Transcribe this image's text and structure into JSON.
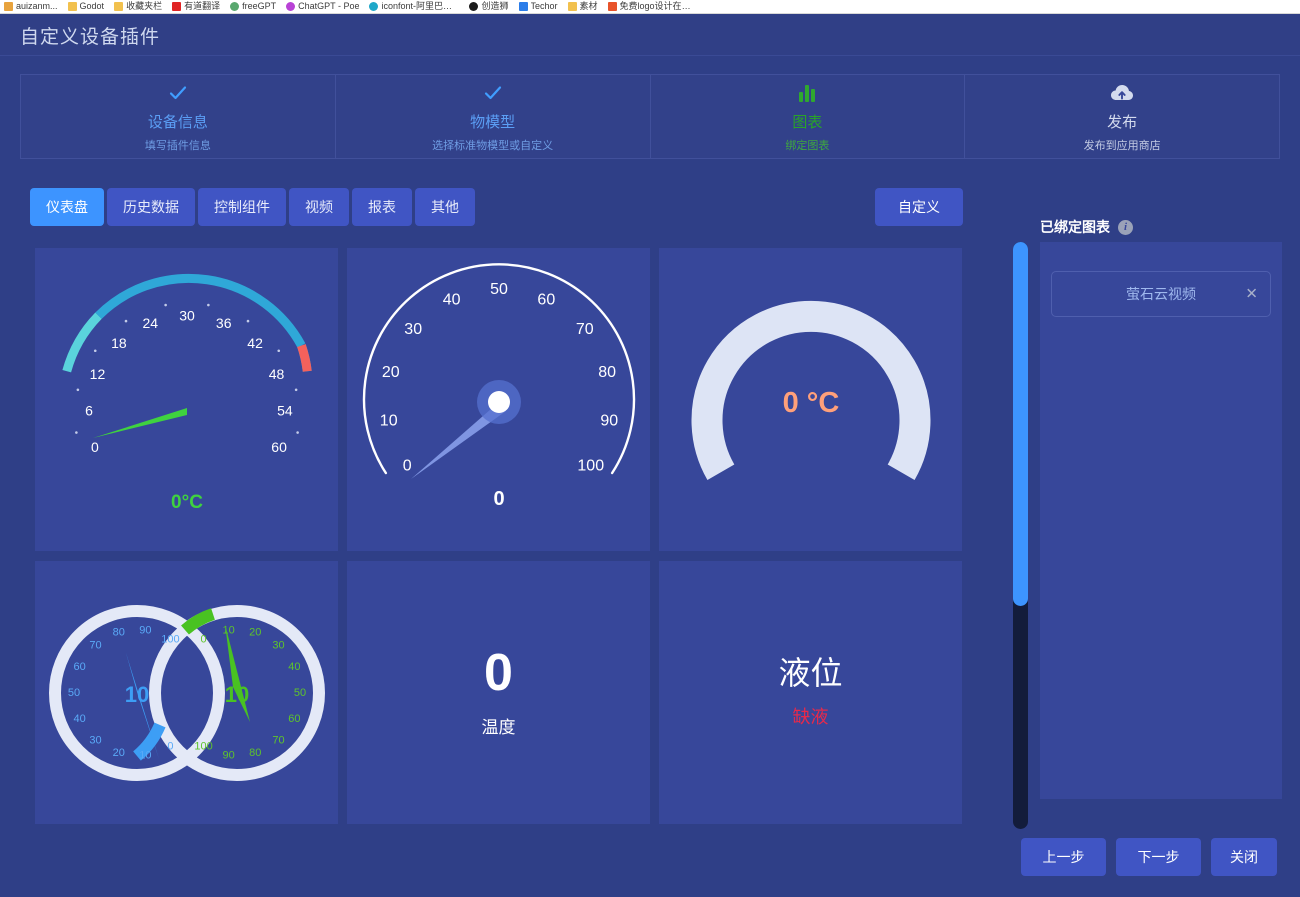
{
  "browser": {
    "bookmarks": [
      {
        "label": "auizanm...",
        "color": "#e8a33d",
        "icon": "bookmark-icon"
      },
      {
        "label": "Godot",
        "color": "#f2c14e",
        "icon": "folder-icon"
      },
      {
        "label": "收藏夹栏",
        "color": "#f2c14e",
        "icon": "folder-icon"
      },
      {
        "label": "有道翻译",
        "color": "#e02424",
        "icon": "youdao-icon"
      },
      {
        "label": "freeGPT",
        "color": "#5aa86f",
        "icon": "freegpt-icon"
      },
      {
        "label": "ChatGPT - Poe",
        "color": "#b942d6",
        "icon": "poe-icon"
      },
      {
        "label": "iconfont-阿里巴巴...",
        "color": "#1fa8c9",
        "icon": "iconfont-icon"
      },
      {
        "label": "创造狮",
        "color": "#1b1b1b",
        "icon": "chuangzaoshi-icon"
      },
      {
        "label": "Techor",
        "color": "#2b7de9",
        "icon": "techor-icon"
      },
      {
        "label": "素材",
        "color": "#f2c14e",
        "icon": "folder-icon"
      },
      {
        "label": "免费logo设计在线...",
        "color": "#e8532a",
        "icon": "logo-design-icon"
      }
    ]
  },
  "header": {
    "title": "自定义设备插件"
  },
  "steps": [
    {
      "title": "设备信息",
      "subtitle": "填写插件信息",
      "icon": "check-icon",
      "state": "done"
    },
    {
      "title": "物模型",
      "subtitle": "选择标准物模型或自定义",
      "icon": "check-icon",
      "state": "done"
    },
    {
      "title": "图表",
      "subtitle": "绑定图表",
      "icon": "bar-chart-icon",
      "state": "active"
    },
    {
      "title": "发布",
      "subtitle": "发布到应用商店",
      "icon": "cloud-upload-icon",
      "state": "pending"
    }
  ],
  "tabs": [
    {
      "label": "仪表盘",
      "selected": true
    },
    {
      "label": "历史数据",
      "selected": false
    },
    {
      "label": "控制组件",
      "selected": false
    },
    {
      "label": "视频",
      "selected": false
    },
    {
      "label": "报表",
      "selected": false
    },
    {
      "label": "其他",
      "selected": false
    }
  ],
  "toolbar": {
    "custom_label": "自定义"
  },
  "bound_panel": {
    "title": "已绑定图表",
    "info_glyph": "i",
    "items": [
      {
        "label": "萤石云视频",
        "remove_glyph": "✕"
      }
    ]
  },
  "footer": {
    "prev_label": "上一步",
    "next_label": "下一步",
    "close_label": "关闭"
  },
  "colors": {
    "page_bg": "#2f3f87",
    "card_bg": "#37479a",
    "accent": "#3d94ff",
    "tab_bg": "#4055c4",
    "green": "#37c837",
    "red": "#f4615c",
    "teal": "#4fd0d8",
    "salmon": "#ffa07a",
    "crimson": "#e8294a"
  },
  "chart_data": [
    {
      "id": "gauge-temperature-60",
      "type": "gauge",
      "title": "",
      "value": 0,
      "value_label": "0°C",
      "min": 0,
      "max": 60,
      "tick_labels": [
        "0",
        "6",
        "12",
        "18",
        "24",
        "30",
        "36",
        "42",
        "48",
        "54",
        "60"
      ],
      "tick_step": 6,
      "start_angle": 200,
      "end_angle": -20,
      "needle_color": "#3fd23f",
      "value_color": "#3fd23f",
      "arc_segments": [
        {
          "from": 0,
          "to": 18,
          "color": "#5ad3dc"
        },
        {
          "from": 18,
          "to": 46,
          "color": "#2fa8d8"
        },
        {
          "from": 46,
          "to": 60,
          "color": "#f4615c"
        }
      ]
    },
    {
      "id": "gauge-percent-100-thin",
      "type": "gauge",
      "title": "",
      "value": 0,
      "value_label": "0",
      "min": 0,
      "max": 100,
      "tick_labels": [
        "0",
        "10",
        "20",
        "30",
        "40",
        "50",
        "60",
        "70",
        "80",
        "90",
        "100"
      ],
      "tick_step": 10,
      "start_angle": 215,
      "end_angle": -35,
      "needle_color": "#7c93e0",
      "value_color": "#ffffff",
      "arc_color": "#ffffff"
    },
    {
      "id": "gauge-temperature-ring",
      "type": "gauge",
      "title": "",
      "value": 0,
      "value_label": "0 °C",
      "min": 0,
      "max": 100,
      "tick_labels": [],
      "start_angle": 210,
      "end_angle": -30,
      "arc_color": "#dde4f5",
      "value_color": "#ffa07a"
    },
    {
      "id": "gauge-dual-100",
      "type": "gauge",
      "sub_gauges": [
        {
          "name": "left",
          "value": 10,
          "value_label": "10",
          "min": 0,
          "max": 100,
          "tick_labels": [
            "0",
            "10",
            "20",
            "30",
            "40",
            "50",
            "60",
            "70",
            "80",
            "90",
            "100"
          ],
          "color": "#3d9ef5",
          "direction": "counterclockwise"
        },
        {
          "name": "right",
          "value": 10,
          "value_label": "10",
          "min": 0,
          "max": 100,
          "tick_labels": [
            "0",
            "10",
            "20",
            "30",
            "40",
            "50",
            "60",
            "70",
            "80",
            "90",
            "100"
          ],
          "color": "#49c222",
          "direction": "clockwise"
        }
      ],
      "ring_color": "#e4e9f7"
    },
    {
      "id": "digit-temperature",
      "type": "digit",
      "value": "0",
      "label": "温度",
      "value_color": "#ffffff",
      "label_color": "#ffffff"
    },
    {
      "id": "status-liquid-level",
      "type": "status",
      "value": "液位",
      "label": "缺液",
      "value_color": "#ffffff",
      "label_color": "#e8294a"
    }
  ]
}
